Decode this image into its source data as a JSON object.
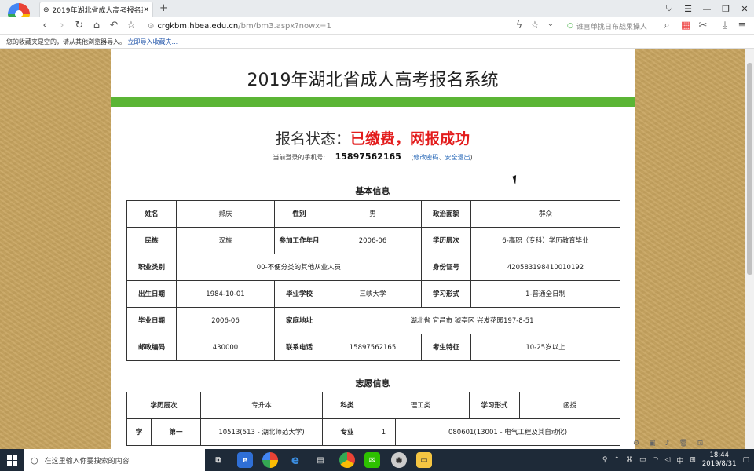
{
  "browser": {
    "tab_title": "2019年湖北省成人高考报名系",
    "url_host": "crgkbm.hbea.edu.cn",
    "url_path": "/bm/bm3.aspx?nowx=1",
    "search_placeholder": "谁喜单挑日布战果操人",
    "bookmarks_text": "您的收藏夹是空的，请从其他浏览器导入。",
    "bookmarks_link": "立即导入收藏夹..."
  },
  "site": {
    "title": "2019年湖北省成人高考报名系统",
    "status_label": "报名状态：",
    "status_value": "已缴费，网报成功",
    "phone_label": "当前登录的手机号:",
    "phone_value": "15897562165",
    "links_open": "(",
    "link_change_pwd": "修改密码",
    "link_sep": "、",
    "link_logout": "安全退出",
    "links_close": ")"
  },
  "basic": {
    "heading": "基本信息",
    "rows": [
      [
        "姓名",
        "郝庆",
        "性别",
        "男",
        "政治面貌",
        "群众"
      ],
      [
        "民族",
        "汉族",
        "参加工作年月",
        "2006-06",
        "学历层次",
        "6-高职（专科）学历教育毕业"
      ],
      [
        "职业类别",
        "00-不便分类的其他从业人员",
        "身份证号",
        "420583198410010192"
      ],
      [
        "出生日期",
        "1984-10-01",
        "毕业学校",
        "三峡大学",
        "学习形式",
        "1-普通全日制"
      ],
      [
        "毕业日期",
        "2006-06",
        "家庭地址",
        "湖北省 宜昌市 猇亭区 兴发花园197-8-51"
      ],
      [
        "邮政编码",
        "430000",
        "联系电话",
        "15897562165",
        "考生特征",
        "10-25岁以上"
      ]
    ]
  },
  "wish": {
    "heading": "志愿信息",
    "row1": [
      "学历层次",
      "专升本",
      "科类",
      "理工类",
      "学习形式",
      "函授"
    ],
    "row2": [
      "学",
      "第一",
      "10513(513 - 湖北师范大学)",
      "专业",
      "1",
      "080601(13001 - 电气工程及其自动化)"
    ]
  },
  "taskbar": {
    "search_placeholder": "在这里输入你要搜索的内容",
    "time": "18:44",
    "date": "2019/8/31",
    "ime": "中"
  }
}
